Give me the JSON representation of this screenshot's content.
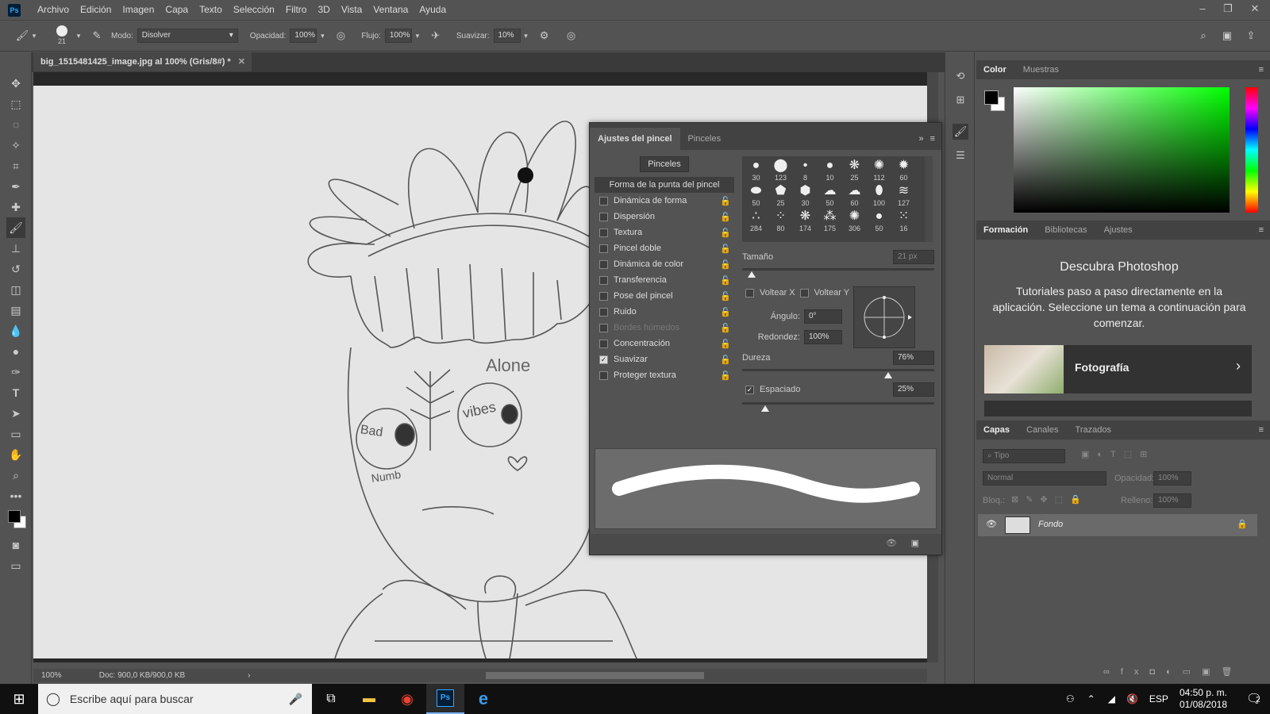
{
  "app": {
    "logo": "Ps"
  },
  "menu": [
    "Archivo",
    "Edición",
    "Imagen",
    "Capa",
    "Texto",
    "Selección",
    "Filtro",
    "3D",
    "Vista",
    "Ventana",
    "Ayuda"
  ],
  "options": {
    "brush_size": "21",
    "mode_label": "Modo:",
    "mode_value": "Disolver",
    "opacity_label": "Opacidad:",
    "opacity_value": "100%",
    "flow_label": "Flujo:",
    "flow_value": "100%",
    "smooth_label": "Suavizar:",
    "smooth_value": "10%"
  },
  "document": {
    "tab_title": "big_1515481425_image.jpg al 100% (Gris/8#) *",
    "zoom": "100%",
    "doc_info": "Doc: 900,0 KB/900,0 KB"
  },
  "drawing_text": {
    "alone": "Alone",
    "vibes": "vibes",
    "bad": "Bad",
    "numb": "Numb"
  },
  "brush_panel": {
    "tabs": [
      "Ajustes del pincel",
      "Pinceles"
    ],
    "brushes_button": "Pinceles",
    "settings": [
      {
        "label": "Forma de la punta del pincel",
        "checkbox": false,
        "checked": false,
        "active": true,
        "lock": false,
        "disabled": false
      },
      {
        "label": "Dinámica de forma",
        "checkbox": true,
        "checked": false,
        "lock": true,
        "disabled": false
      },
      {
        "label": "Dispersión",
        "checkbox": true,
        "checked": false,
        "lock": true,
        "disabled": false
      },
      {
        "label": "Textura",
        "checkbox": true,
        "checked": false,
        "lock": true,
        "disabled": false
      },
      {
        "label": "Pincel doble",
        "checkbox": true,
        "checked": false,
        "lock": true,
        "disabled": false
      },
      {
        "label": "Dinámica de color",
        "checkbox": true,
        "checked": false,
        "lock": true,
        "disabled": false
      },
      {
        "label": "Transferencia",
        "checkbox": true,
        "checked": false,
        "lock": true,
        "disabled": false
      },
      {
        "label": "Pose del pincel",
        "checkbox": true,
        "checked": false,
        "lock": true,
        "disabled": false
      },
      {
        "label": "Ruido",
        "checkbox": true,
        "checked": false,
        "lock": true,
        "disabled": false
      },
      {
        "label": "Bordes húmedos",
        "checkbox": true,
        "checked": false,
        "lock": true,
        "disabled": true
      },
      {
        "label": "Concentración",
        "checkbox": true,
        "checked": false,
        "lock": true,
        "disabled": false
      },
      {
        "label": "Suavizar",
        "checkbox": true,
        "checked": true,
        "lock": true,
        "disabled": false
      },
      {
        "label": "Proteger textura",
        "checkbox": true,
        "checked": false,
        "lock": true,
        "disabled": false
      }
    ],
    "tips": [
      [
        "30",
        "123",
        "8",
        "10",
        "25",
        "112",
        "60"
      ],
      [
        "50",
        "25",
        "30",
        "50",
        "60",
        "100",
        "127"
      ],
      [
        "284",
        "80",
        "174",
        "175",
        "306",
        "50",
        "16"
      ]
    ],
    "size_label": "Tamaño",
    "size_value": "21 px",
    "flip_x": "Voltear X",
    "flip_y": "Voltear Y",
    "angle_label": "Ángulo:",
    "angle_value": "0°",
    "roundness_label": "Redondez:",
    "roundness_value": "100%",
    "hardness_label": "Dureza",
    "hardness_value": "76%",
    "spacing_label": "Espaciado",
    "spacing_value": "25%",
    "size_slider_level": 0.05,
    "hardness_slider_level": 0.76,
    "spacing_slider_level": 0.12
  },
  "color_panel": {
    "tabs": [
      "Color",
      "Muestras"
    ]
  },
  "learn_panel": {
    "tabs": [
      "Formación",
      "Bibliotecas",
      "Ajustes"
    ],
    "title": "Descubra Photoshop",
    "description": "Tutoriales paso a paso directamente en la aplicación. Seleccione un tema a continuación para comenzar.",
    "card_title": "Fotografía"
  },
  "layers_panel": {
    "tabs": [
      "Capas",
      "Canales",
      "Trazados"
    ],
    "filter_placeholder": "Tipo",
    "blend_mode": "Normal",
    "opacity_label": "Opacidad:",
    "opacity_value": "100%",
    "lock_label": "Bloq.:",
    "fill_label": "Relleno:",
    "fill_value": "100%",
    "layer_name": "Fondo"
  },
  "taskbar": {
    "search_placeholder": "Escribe aquí para buscar",
    "language": "ESP",
    "time": "04:50 p. m.",
    "date": "01/08/2018",
    "notifications": "2"
  },
  "colors": {
    "accent": "#31a8ff",
    "ui_bg": "#535353",
    "panel_dark": "#424242"
  }
}
